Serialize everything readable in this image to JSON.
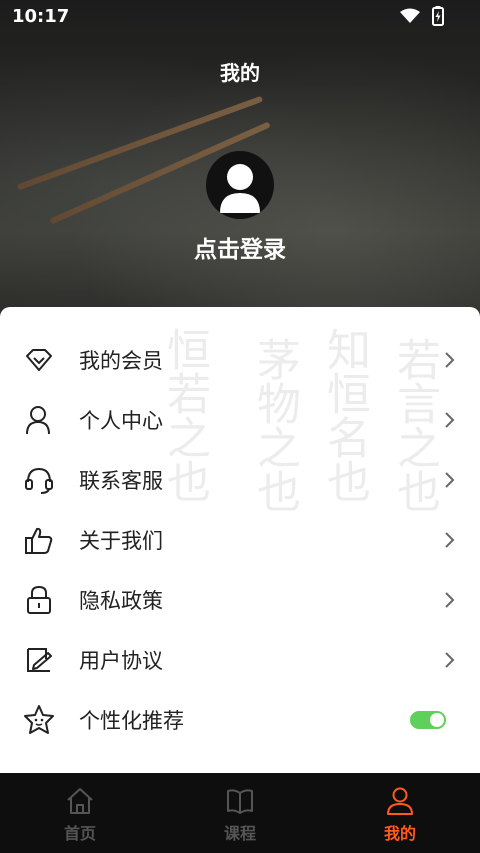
{
  "status_bar": {
    "time": "10:17",
    "icons": [
      "wifi-icon",
      "battery-charging-icon"
    ]
  },
  "header": {
    "title": "我的",
    "avatar_icon": "user-silhouette-icon",
    "login_label": "点击登录"
  },
  "menu": {
    "items": [
      {
        "label": "我的会员",
        "icon": "diamond-icon",
        "trailing": "chevron"
      },
      {
        "label": "个人中心",
        "icon": "person-icon",
        "trailing": "chevron"
      },
      {
        "label": "联系客服",
        "icon": "headset-icon",
        "trailing": "chevron"
      },
      {
        "label": "关于我们",
        "icon": "thumbs-up-icon",
        "trailing": "chevron"
      },
      {
        "label": "隐私政策",
        "icon": "lock-icon",
        "trailing": "chevron"
      },
      {
        "label": "用户协议",
        "icon": "agreement-icon",
        "trailing": "chevron"
      },
      {
        "label": "个性化推荐",
        "icon": "star-face-icon",
        "trailing": "toggle",
        "enabled": true
      }
    ]
  },
  "tabbar": {
    "items": [
      {
        "label": "首页",
        "icon": "home-icon",
        "active": false
      },
      {
        "label": "课程",
        "icon": "book-icon",
        "active": false
      },
      {
        "label": "我的",
        "icon": "profile-icon",
        "active": true
      }
    ]
  },
  "colors": {
    "accent": "#ff5a1f",
    "toggle_on": "#5fd05b",
    "inactive_tab": "#555555",
    "text": "#222222"
  }
}
